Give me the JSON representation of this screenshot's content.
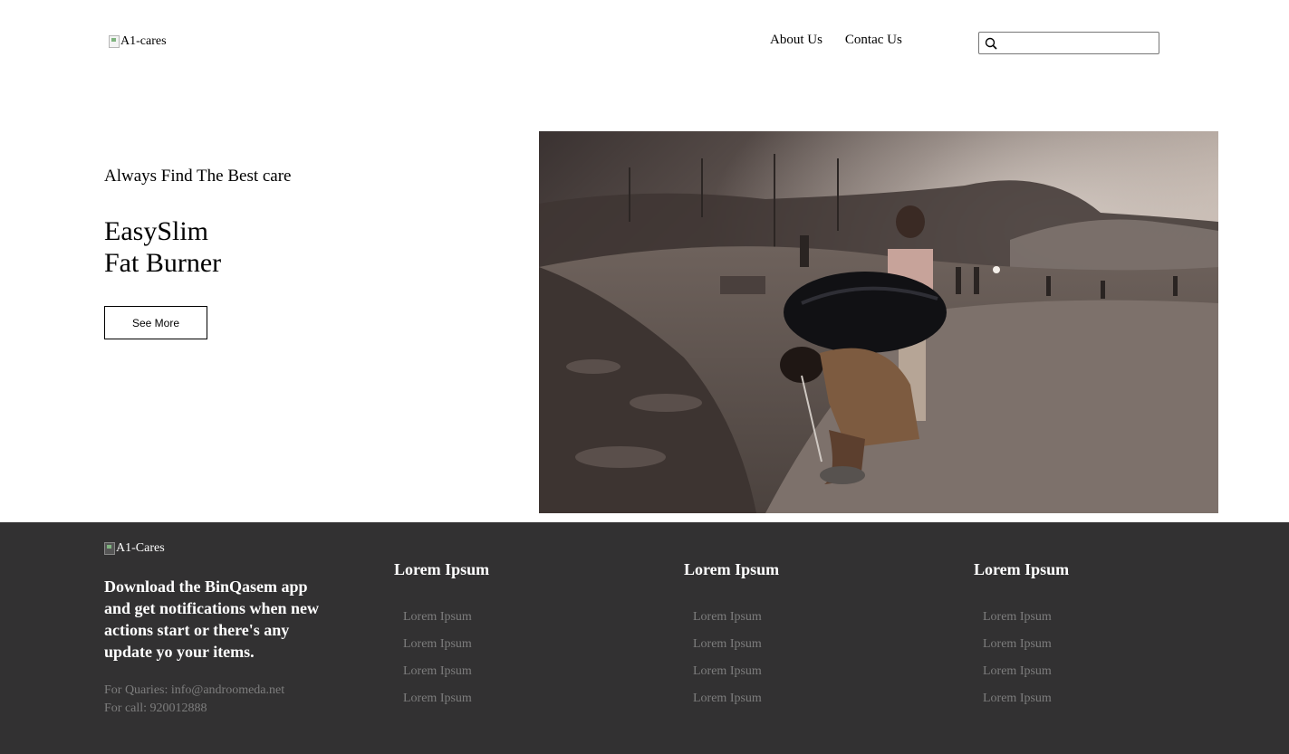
{
  "header": {
    "logo_alt": "A1-cares",
    "nav": [
      {
        "label": "About Us"
      },
      {
        "label": "Contac Us"
      }
    ],
    "search": {
      "placeholder": "",
      "value": ""
    }
  },
  "hero": {
    "tagline": "Always Find The Best care",
    "product_line1": "EasySlim",
    "product_line2": "Fat Burner",
    "cta_label": "See More"
  },
  "footer": {
    "logo_alt": "A1-Cares",
    "app_text": "Download the BinQasem app and get notifications when new actions start or there's any update yo your items.",
    "contact_email": "For Quaries: info@androomeda.net",
    "contact_phone": "For call: 920012888",
    "columns": [
      {
        "title": "Lorem Ipsum",
        "links": [
          "Lorem Ipsum",
          "Lorem Ipsum",
          "Lorem Ipsum",
          "Lorem Ipsum"
        ]
      },
      {
        "title": "Lorem Ipsum",
        "links": [
          "Lorem Ipsum",
          "Lorem Ipsum",
          "Lorem Ipsum",
          "Lorem Ipsum"
        ]
      },
      {
        "title": "Lorem Ipsum",
        "links": [
          "Lorem Ipsum",
          "Lorem Ipsum",
          "Lorem Ipsum",
          "Lorem Ipsum"
        ]
      }
    ]
  },
  "colors": {
    "footer_bg": "#323132",
    "footer_muted": "#7d7d7d"
  }
}
